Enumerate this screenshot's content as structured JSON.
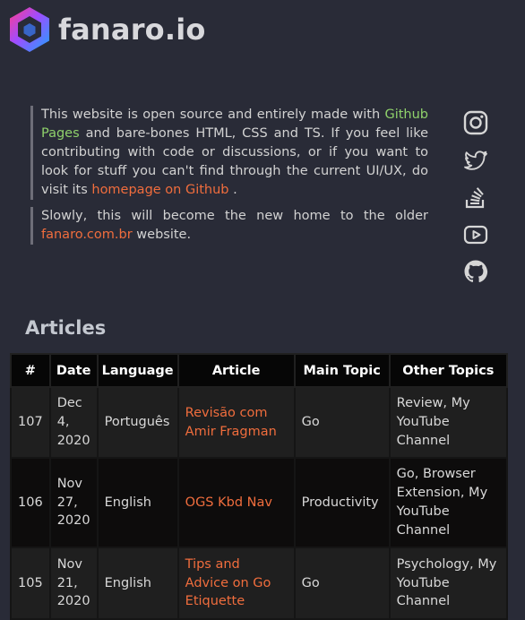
{
  "brand": {
    "name": "fanaro.io",
    "logo_icon": "hexagon-logo-icon"
  },
  "intro": {
    "p1_before": "This website is open source and entirely made with ",
    "p1_link1": "Github Pages",
    "p1_middle": " and bare-bones HTML, CSS and TS. If you feel like contributing with code or discussions, or if you want to look for stuff you can't find through the current UI/UX, do visit its ",
    "p1_link2": "homepage on Github",
    "p1_after": " .",
    "p2_before": "Slowly, this will become the new home to the older ",
    "p2_link": "fanaro.com.br",
    "p2_after": " website."
  },
  "social": [
    "instagram-icon",
    "twitter-icon",
    "stackoverflow-icon",
    "youtube-icon",
    "github-icon"
  ],
  "articles": {
    "title": "Articles",
    "headers": [
      "#",
      "Date",
      "Language",
      "Article",
      "Main Topic",
      "Other Topics"
    ],
    "rows": [
      {
        "num": "107",
        "date": "Dec 4, 2020",
        "language": "Português",
        "article": "Revisão com Amir Fragman",
        "main_topic": "Go",
        "other_topics": "Review, My YouTube Channel"
      },
      {
        "num": "106",
        "date": "Nov 27, 2020",
        "language": "English",
        "article": "OGS Kbd Nav",
        "main_topic": "Productivity",
        "other_topics": "Go, Browser Extension, My YouTube Channel"
      },
      {
        "num": "105",
        "date": "Nov 21, 2020",
        "language": "English",
        "article": "Tips and Advice on Go Etiquette",
        "main_topic": "Go",
        "other_topics": "Psychology, My YouTube Channel"
      }
    ]
  },
  "colors": {
    "background": "#292b37",
    "link_green": "#8fd16b",
    "link_orange": "#f06d3d"
  }
}
